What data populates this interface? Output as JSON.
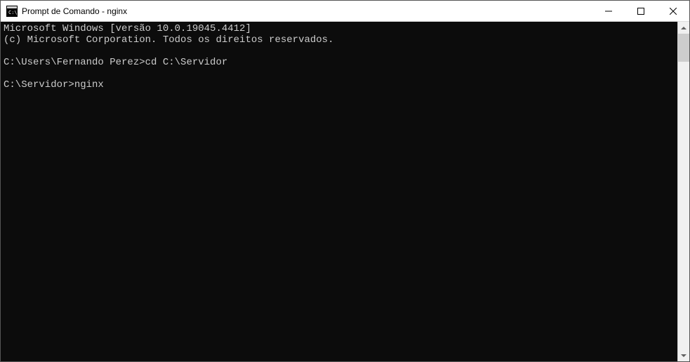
{
  "window": {
    "title": "Prompt de Comando - nginx"
  },
  "console": {
    "lines": [
      "Microsoft Windows [versão 10.0.19045.4412]",
      "(c) Microsoft Corporation. Todos os direitos reservados.",
      "",
      "C:\\Users\\Fernando Perez>cd C:\\Servidor",
      "",
      "C:\\Servidor>nginx"
    ]
  }
}
